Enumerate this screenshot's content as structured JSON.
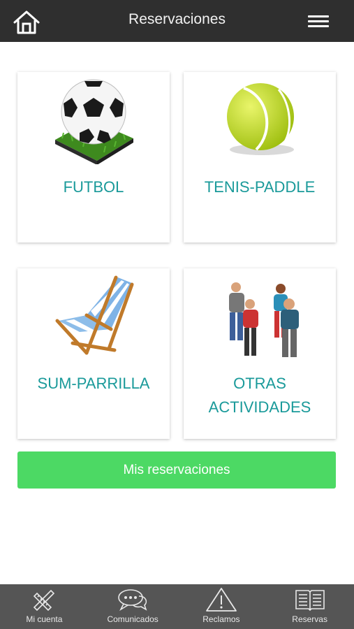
{
  "header": {
    "title": "Reservaciones",
    "home_icon": "home-icon",
    "menu_icon": "hamburger-menu-icon"
  },
  "cards": [
    {
      "label": "FUTBOL",
      "icon": "soccer-ball-icon"
    },
    {
      "label": "TENIS-PADDLE",
      "icon": "tennis-ball-icon"
    },
    {
      "label": "SUM-PARRILLA",
      "icon": "beach-chair-icon"
    },
    {
      "label_line1": "OTRAS",
      "label_line2": "ACTIVIDADES",
      "icon": "people-group-icon"
    }
  ],
  "main": {
    "mis_reservaciones_label": "Mis reservaciones"
  },
  "bottom_nav": [
    {
      "label": "Mi cuenta",
      "icon": "pencil-ruler-icon"
    },
    {
      "label": "Comunicados",
      "icon": "chat-bubbles-icon"
    },
    {
      "label": "Reclamos",
      "icon": "warning-icon"
    },
    {
      "label": "Reservas",
      "icon": "book-icon"
    }
  ],
  "colors": {
    "header_bg": "#2f2f2f",
    "accent_text": "#1a9a9a",
    "button_green": "#4cd964",
    "nav_bg": "#555555"
  }
}
